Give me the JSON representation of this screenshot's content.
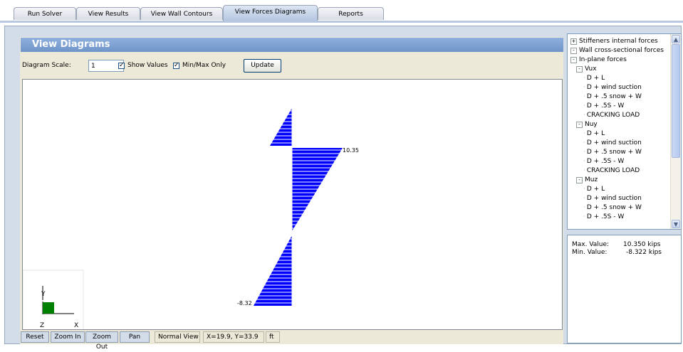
{
  "tabs": [
    {
      "label": "Run Solver",
      "active": false
    },
    {
      "label": "View Results",
      "active": false
    },
    {
      "label": "View Wall Contours",
      "active": false
    },
    {
      "label": "View Forces Diagrams",
      "active": true
    },
    {
      "label": "Reports",
      "active": false
    }
  ],
  "panel": {
    "title": "View Diagrams"
  },
  "toolbar": {
    "scale_label": "Diagram Scale:",
    "scale_value": "1",
    "show_values_label": "Show Values",
    "show_values_checked": true,
    "minmax_label": "Min/Max Only",
    "minmax_checked": true,
    "update_label": "Update"
  },
  "diagram": {
    "max_label": "10.35",
    "min_label": "-8.32",
    "color": "#0000ff",
    "axes": {
      "y": "Y",
      "z": "Z",
      "x": "X"
    }
  },
  "bottombar": {
    "reset": "Reset",
    "zoom_in": "Zoom In",
    "zoom_out": "Zoom Out",
    "pan": "Pan",
    "view_mode": "Normal View",
    "coords": "X=19.9, Y=33.9",
    "units": "ft"
  },
  "tree": [
    {
      "label": "Stiffeners internal forces",
      "level": 0,
      "toggle": "+"
    },
    {
      "label": "Wall cross-sectional forces",
      "level": 0,
      "toggle": "-"
    },
    {
      "label": "In-plane forces",
      "level": 1,
      "toggle": "-"
    },
    {
      "label": "Vux",
      "level": 2,
      "toggle": "-"
    },
    {
      "label": "D + L",
      "level": 3
    },
    {
      "label": "D + wind suction",
      "level": 3
    },
    {
      "label": "D + .5 snow + W",
      "level": 3
    },
    {
      "label": "D + .5S - W",
      "level": 3
    },
    {
      "label": "CRACKING LOAD",
      "level": 3
    },
    {
      "label": "Nuy",
      "level": 2,
      "toggle": "-"
    },
    {
      "label": "D + L",
      "level": 3
    },
    {
      "label": "D + wind suction",
      "level": 3
    },
    {
      "label": "D + .5 snow + W",
      "level": 3
    },
    {
      "label": "D + .5S - W",
      "level": 3
    },
    {
      "label": "CRACKING LOAD",
      "level": 3
    },
    {
      "label": "Muz",
      "level": 2,
      "toggle": "-"
    },
    {
      "label": "D + L",
      "level": 3
    },
    {
      "label": "D + wind suction",
      "level": 3
    },
    {
      "label": "D + .5 snow + W",
      "level": 3
    },
    {
      "label": "D + .5S - W",
      "level": 3
    }
  ],
  "info": {
    "max_label": "Max. Value:",
    "max_value": "10.350 kips",
    "min_label": "Min. Value:",
    "min_value": "-8.322 kips"
  }
}
